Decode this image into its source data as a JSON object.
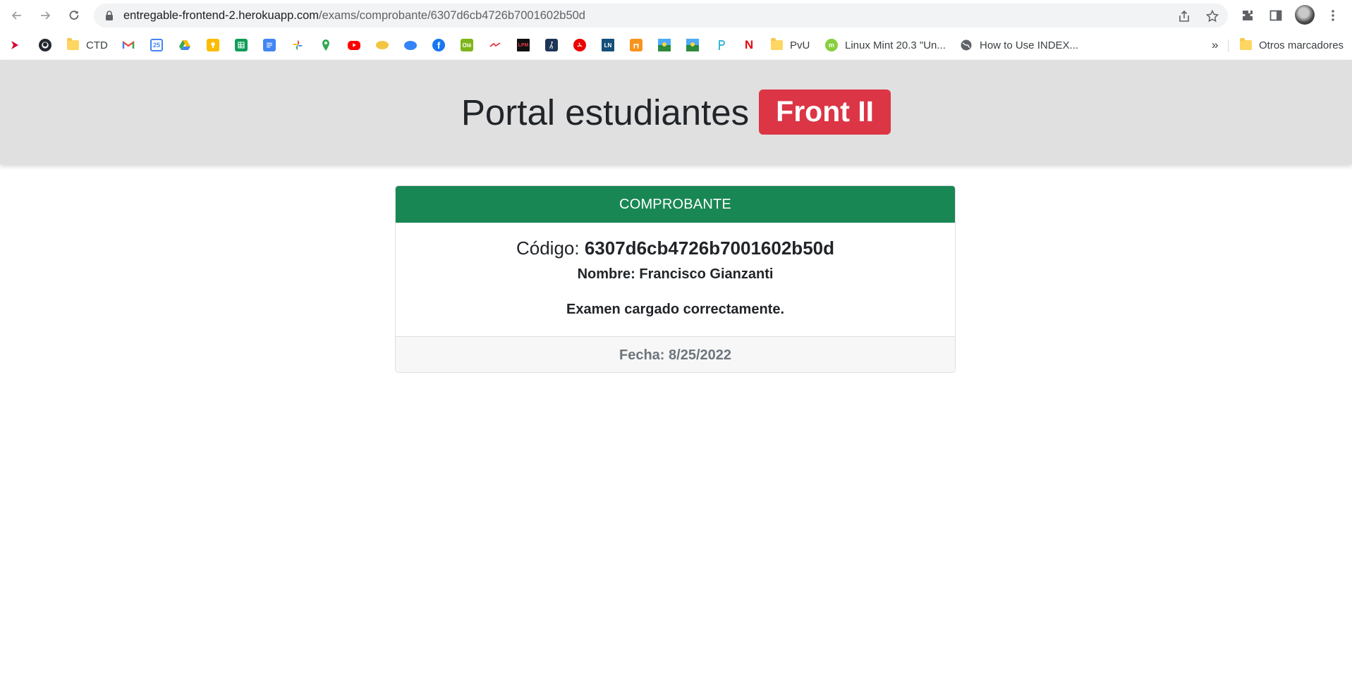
{
  "browser": {
    "url_host": "entregable-frontend-2.herokuapp.com",
    "url_path": "/exams/comprobante/6307d6cb4726b7001602b50d",
    "bookmarks": [
      {
        "label": "",
        "icon": "arrow-red-icon"
      },
      {
        "label": "",
        "icon": "github-icon"
      },
      {
        "label": "CTD",
        "icon": "folder-icon"
      },
      {
        "label": "",
        "icon": "gmail-icon"
      },
      {
        "label": "",
        "icon": "calendar-icon",
        "text": "25"
      },
      {
        "label": "",
        "icon": "drive-icon"
      },
      {
        "label": "",
        "icon": "keep-icon"
      },
      {
        "label": "",
        "icon": "sheets-icon"
      },
      {
        "label": "",
        "icon": "docs-icon"
      },
      {
        "label": "",
        "icon": "photos-icon"
      },
      {
        "label": "",
        "icon": "maps-icon"
      },
      {
        "label": "",
        "icon": "youtube-icon"
      },
      {
        "label": "",
        "icon": "bank-icon"
      },
      {
        "label": "",
        "icon": "mercadolibre-icon"
      },
      {
        "label": "",
        "icon": "facebook-icon"
      },
      {
        "label": "",
        "icon": "ole-icon",
        "text": "Olé"
      },
      {
        "label": "",
        "icon": "sport-icon"
      },
      {
        "label": "",
        "icon": "lpm-icon",
        "text": "LPM"
      },
      {
        "label": "",
        "icon": "hiking-icon"
      },
      {
        "label": "",
        "icon": "santander-icon"
      },
      {
        "label": "",
        "icon": "ln-icon",
        "text": "LN"
      },
      {
        "label": "",
        "icon": "orange-icon"
      },
      {
        "label": "",
        "icon": "landscape-icon"
      },
      {
        "label": "",
        "icon": "landscape2-icon"
      },
      {
        "label": "",
        "icon": "p-icon"
      },
      {
        "label": "",
        "icon": "netflix-icon",
        "text": "N"
      },
      {
        "label": "PvU",
        "icon": "folder-icon"
      },
      {
        "label": "Linux Mint 20.3 \"Un...",
        "icon": "mint-icon"
      },
      {
        "label": "How to Use INDEX...",
        "icon": "globe-icon"
      }
    ],
    "overflow": "»",
    "other_bookmarks": "Otros marcadores",
    "colors": {
      "chrome_bg": "#ffffff",
      "omnibox_bg": "#f1f3f4"
    }
  },
  "header": {
    "title": "Portal estudiantes",
    "badge": "Front II",
    "colors": {
      "bg": "#e0e0e0",
      "badge": "#dc3545"
    }
  },
  "card": {
    "header": "COMPROBANTE",
    "code_label": "Código:",
    "code_value": "6307d6cb4726b7001602b50d",
    "name_label": "Nombre:",
    "name_value": "Francisco Gianzanti",
    "status": "Examen cargado correctamente.",
    "date_label": "Fecha:",
    "date_value": "8/25/2022",
    "colors": {
      "header": "#198754",
      "footer": "#f7f7f7"
    }
  }
}
